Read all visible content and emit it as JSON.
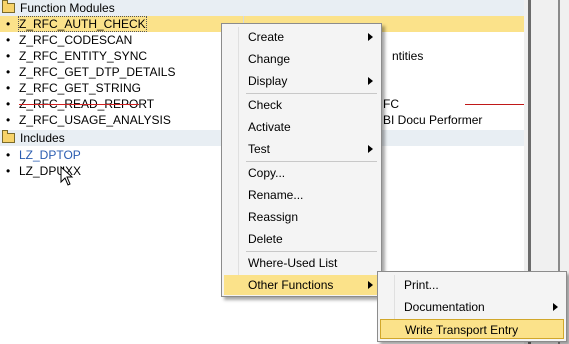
{
  "tree": {
    "folders": [
      {
        "label": "Function Modules",
        "icon": "folder-icon"
      },
      {
        "label": "Includes",
        "icon": "folder-icon"
      }
    ],
    "function_modules": [
      {
        "name": "Z_RFC_AUTH_CHECK",
        "desc": ""
      },
      {
        "name": "Z_RFC_CODESCAN",
        "desc": ""
      },
      {
        "name": "Z_RFC_ENTITY_SYNC",
        "desc": "ntities"
      },
      {
        "name": "Z_RFC_GET_DTP_DETAILS",
        "desc": ""
      },
      {
        "name": "Z_RFC_GET_STRING",
        "desc": ""
      },
      {
        "name": "Z_RFC_READ_REPORT",
        "desc": "FC"
      },
      {
        "name": "Z_RFC_USAGE_ANALYSIS",
        "desc": "BI Docu Performer"
      }
    ],
    "includes": [
      {
        "name": "LZ_DPTOP"
      },
      {
        "name": "LZ_DPUXX"
      }
    ],
    "bullet": "•"
  },
  "context_menu": {
    "items": [
      {
        "label": "Create",
        "submenu": true
      },
      {
        "label": "Change",
        "submenu": false
      },
      {
        "label": "Display",
        "submenu": true
      },
      {
        "label": "Check",
        "submenu": false
      },
      {
        "label": "Activate",
        "submenu": false
      },
      {
        "label": "Test",
        "submenu": true
      },
      {
        "label": "Copy...",
        "submenu": false
      },
      {
        "label": "Rename...",
        "submenu": false
      },
      {
        "label": "Reassign",
        "submenu": false
      },
      {
        "label": "Delete",
        "submenu": false
      },
      {
        "label": "Where-Used List",
        "submenu": false
      },
      {
        "label": "Other Functions",
        "submenu": true
      }
    ]
  },
  "submenu": {
    "items": [
      {
        "label": "Print...",
        "submenu": false
      },
      {
        "label": "Documentation",
        "submenu": true
      },
      {
        "label": "Write Transport Entry",
        "submenu": false
      }
    ]
  },
  "colors": {
    "selection": "#fbe28a",
    "folder_row": "#e8eef3",
    "include_link": "#2a5cb0",
    "red_line": "#c01818"
  }
}
